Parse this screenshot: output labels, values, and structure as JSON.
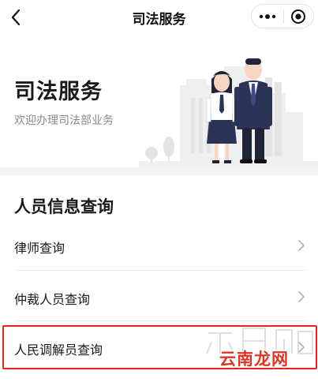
{
  "navbar": {
    "title": "司法服务"
  },
  "banner": {
    "title": "司法服务",
    "subtitle": "欢迎办理司法部业务"
  },
  "section": {
    "title": "人员信息查询",
    "items": [
      {
        "label": "律师查询"
      },
      {
        "label": "仲裁人员查询"
      },
      {
        "label": "人民调解员查询"
      }
    ]
  },
  "watermark": {
    "text": "云南龙网"
  },
  "colors": {
    "highlight": "#e0261f",
    "watermark": "#d9362b",
    "suit": "#2b3357"
  }
}
